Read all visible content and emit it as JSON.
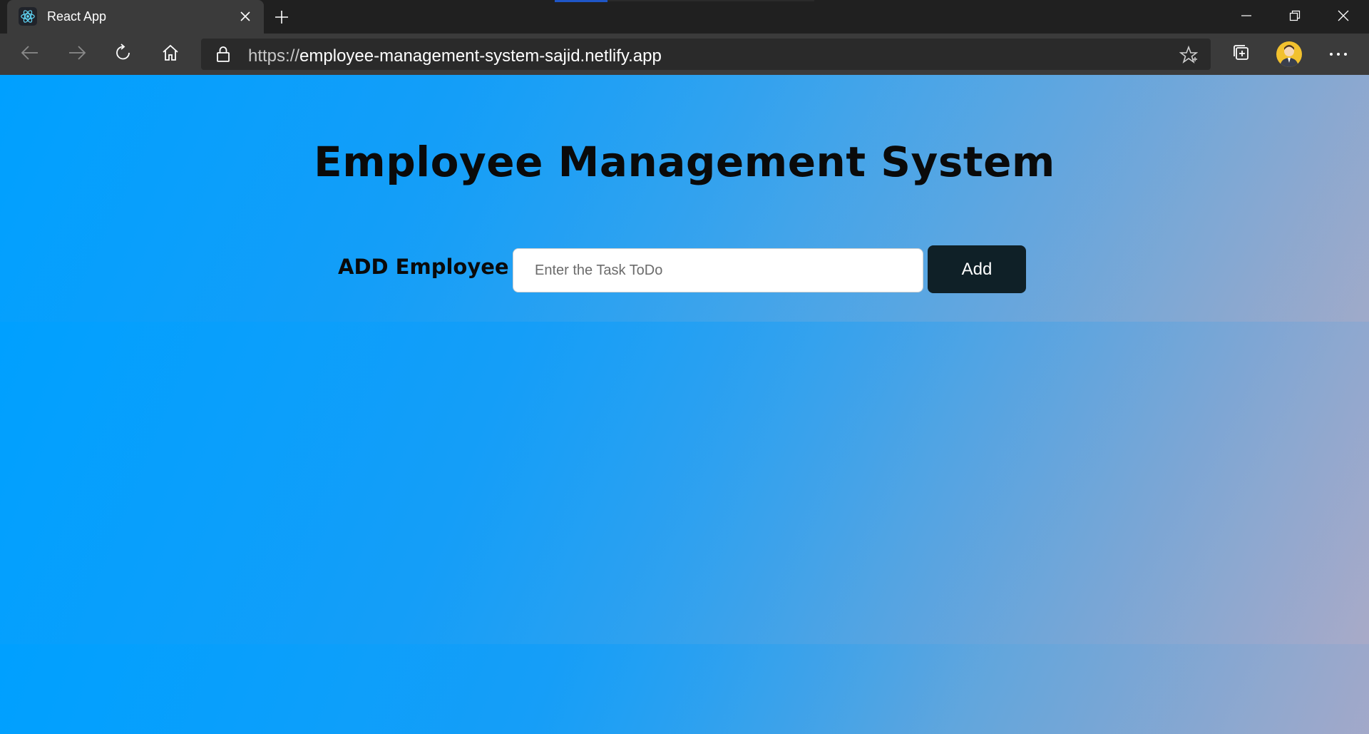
{
  "browser": {
    "tab": {
      "title": "React App",
      "favicon": "react-logo-icon"
    },
    "address": {
      "scheme": "https://",
      "host": "employee-management-system-sajid.netlify.app"
    },
    "icons": {
      "back": "arrow-left-icon",
      "forward": "arrow-right-icon",
      "refresh": "refresh-icon",
      "home": "home-icon",
      "favorite": "star-icon",
      "collections": "collections-icon",
      "menu": "more-icon"
    }
  },
  "app": {
    "title": "Employee Management System",
    "add_label": "ADD Employee :",
    "input_placeholder": "Enter the Task ToDo",
    "add_button": "Add"
  },
  "colors": {
    "accent_start": "#00a0ff",
    "accent_end": "#b5aec3",
    "button_bg": "#0f2027"
  }
}
